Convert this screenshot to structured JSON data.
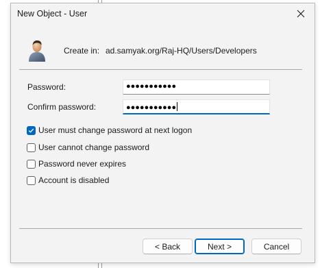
{
  "window": {
    "title": "New Object - User"
  },
  "header": {
    "create_in_label": "Create in:",
    "create_in_path": "ad.samyak.org/Raj-HQ/Users/Developers"
  },
  "form": {
    "password_label": "Password:",
    "password_value": "●●●●●●●●●●●",
    "confirm_label": "Confirm password:",
    "confirm_value": "●●●●●●●●●●●"
  },
  "options": [
    {
      "label": "User must change password at next logon",
      "checked": true
    },
    {
      "label": "User cannot change password",
      "checked": false
    },
    {
      "label": "Password never expires",
      "checked": false
    },
    {
      "label": "Account is disabled",
      "checked": false
    }
  ],
  "buttons": {
    "back": "< Back",
    "next": "Next >",
    "cancel": "Cancel"
  },
  "colors": {
    "accent": "#0067c0",
    "dialog_bg": "#f3f3f3"
  },
  "icons": {
    "close": "close-icon",
    "user": "user-icon",
    "check": "checkmark-icon"
  }
}
